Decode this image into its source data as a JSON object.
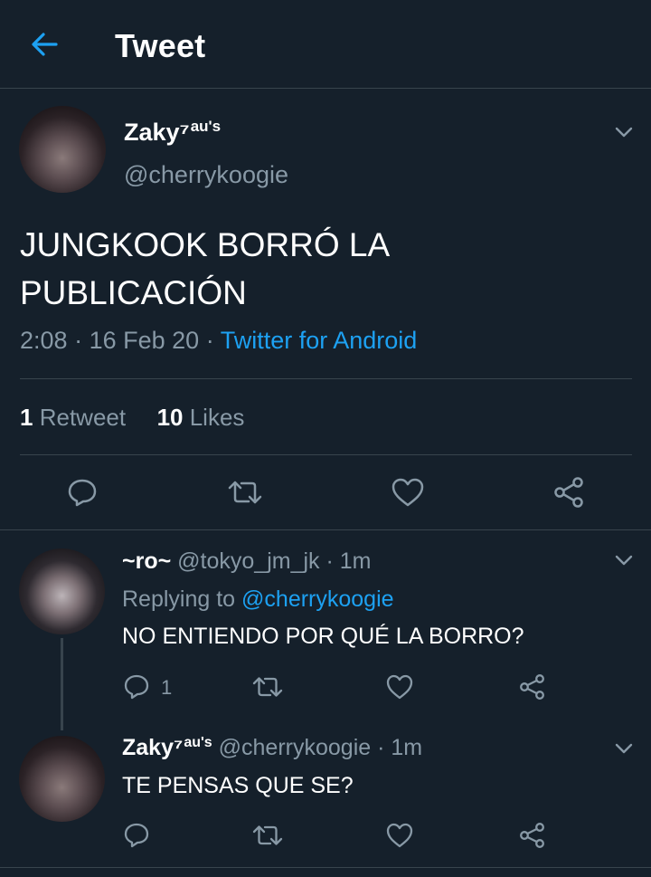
{
  "header": {
    "title": "Tweet",
    "back_icon": "arrow-left-icon",
    "accent": "#1da1f2"
  },
  "colors": {
    "background": "#15202b",
    "divider": "#38444d",
    "secondary_text": "#8899a6",
    "link": "#1da1f2"
  },
  "main_tweet": {
    "author_name": "Zaky⁷",
    "author_badge": "au's",
    "author_handle": "@cherrykoogie",
    "text_line1": "JUNGKOOK BORRÓ LA",
    "text_line2": "PUBLICACIÓN",
    "time": "2:08",
    "date": "16 Feb 20",
    "separator": "·",
    "source": "Twitter for Android",
    "retweet_count": "1",
    "retweet_label": "Retweet",
    "like_count": "10",
    "like_label": "Likes"
  },
  "replies": [
    {
      "author_name": "~ro~",
      "author_handle": "@tokyo_jm_jk",
      "separator": "·",
      "time": "1m",
      "replying_label": "Replying to",
      "replying_handle": "@cherrykoogie",
      "text": "NO ENTIENDO POR QUÉ LA BORRO?",
      "reply_count": "1"
    },
    {
      "author_name": "Zaky⁷",
      "author_badge": "au's",
      "author_handle": "@cherrykoogie",
      "separator": "·",
      "time": "1m",
      "text": "TE PENSAS QUE SE?"
    }
  ]
}
